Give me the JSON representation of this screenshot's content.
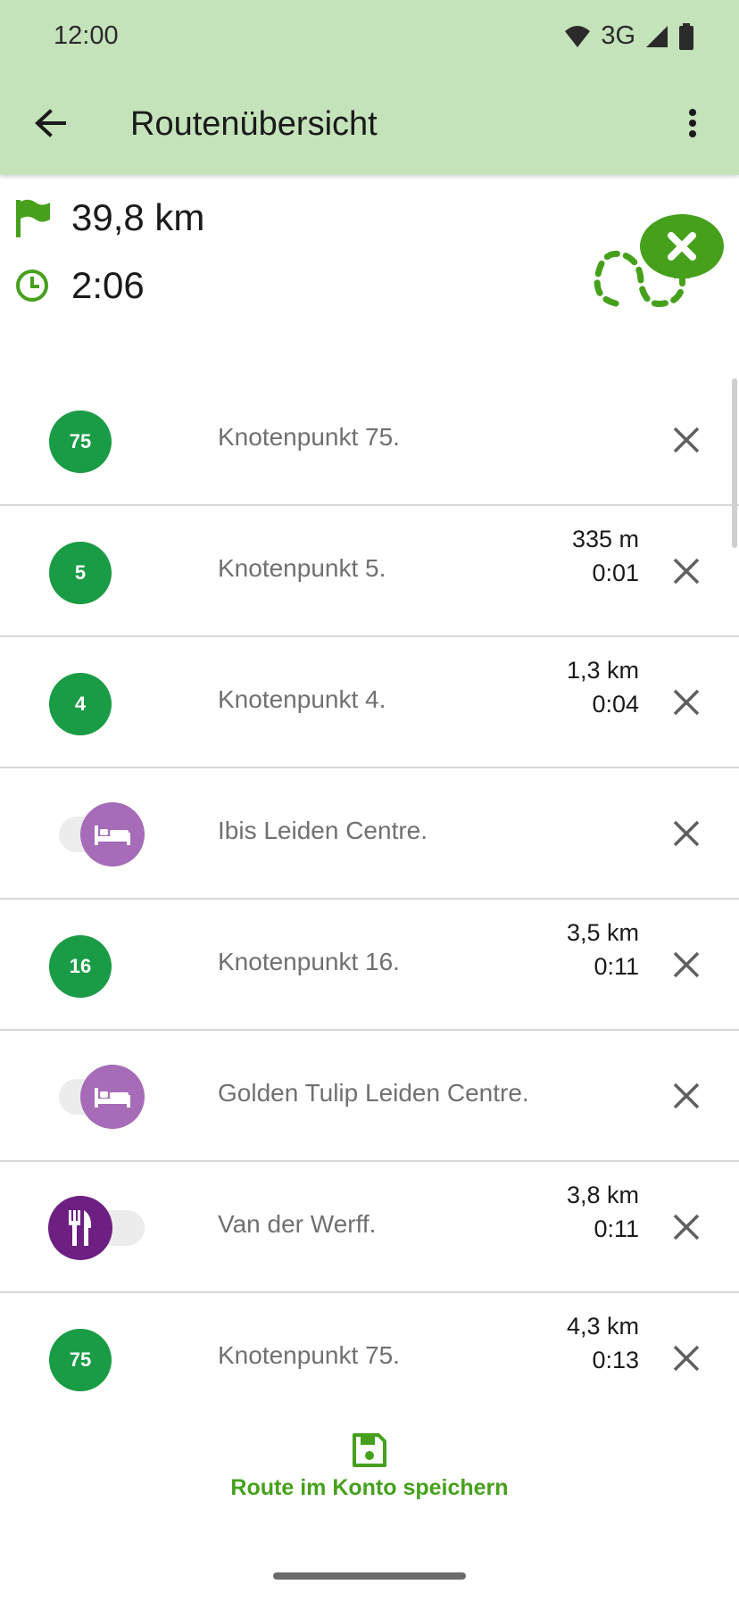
{
  "status_bar": {
    "time": "12:00",
    "network": "3G"
  },
  "app_bar": {
    "title": "Routenübersicht"
  },
  "summary": {
    "distance": "39,8 km",
    "duration": "2:06"
  },
  "route_items": [
    {
      "kind": "node",
      "badge": "75",
      "name": "Knotenpunkt 75.",
      "distance": "",
      "time": ""
    },
    {
      "kind": "node",
      "badge": "5",
      "name": "Knotenpunkt 5.",
      "distance": "335 m",
      "time": "0:01"
    },
    {
      "kind": "node",
      "badge": "4",
      "name": "Knotenpunkt 4.",
      "distance": "1,3 km",
      "time": "0:04"
    },
    {
      "kind": "hotel",
      "badge": "",
      "name": "Ibis Leiden Centre.",
      "distance": "",
      "time": ""
    },
    {
      "kind": "node",
      "badge": "16",
      "name": "Knotenpunkt 16.",
      "distance": "3,5 km",
      "time": "0:11"
    },
    {
      "kind": "hotel",
      "badge": "",
      "name": "Golden Tulip Leiden Centre.",
      "distance": "",
      "time": ""
    },
    {
      "kind": "food",
      "badge": "",
      "name": "Van der Werff.",
      "distance": "3,8 km",
      "time": "0:11"
    },
    {
      "kind": "node",
      "badge": "75",
      "name": "Knotenpunkt 75.",
      "distance": "4,3 km",
      "time": "0:13"
    }
  ],
  "bottom": {
    "save_label": "Route im Konto speichern"
  },
  "colors": {
    "appbar": "#c5e3bb",
    "node_badge": "#1a9b45",
    "hotel": "#a66cb8",
    "food": "#6d1f82",
    "accent": "#46a01c"
  },
  "icons": {
    "back": "arrow-left-icon",
    "menu": "more-vert-icon",
    "flag": "flag-icon",
    "clock": "clock-icon",
    "clear_route": "clear-route-icon",
    "remove": "close-icon",
    "hotel": "bed-icon",
    "food": "cutlery-icon",
    "save": "floppy-disk-icon"
  }
}
